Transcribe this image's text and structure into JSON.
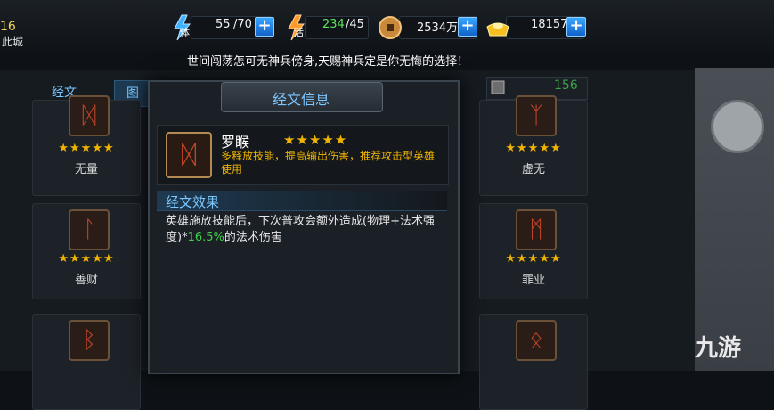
{
  "player": {
    "level": "16",
    "city": "此城"
  },
  "resources": [
    {
      "name": "stamina",
      "icon_label": "体",
      "value": "55",
      "max": "/70"
    },
    {
      "name": "energy",
      "icon_label": "活",
      "value": "234",
      "max": "/45"
    },
    {
      "name": "coins",
      "value": "2534万"
    },
    {
      "name": "gold",
      "value": "18157"
    }
  ],
  "slogan": "世间闯荡怎可无神兵傍身,天赐神兵定是你无悔的选择！",
  "tabs": {
    "left": "经文",
    "second": "图"
  },
  "counter": "156",
  "cards": [
    {
      "name": "无量",
      "stars": "★★★★★"
    },
    {
      "name": "善财",
      "stars": "★★★★★"
    },
    {
      "name": "虚无",
      "stars": "★★★★★"
    },
    {
      "name": "罪业",
      "stars": "★★★★★"
    }
  ],
  "dialog": {
    "title": "经文信息",
    "item": {
      "name": "罗睺",
      "stars": "★★★★★",
      "desc": "多释放技能，提高输出伤害，推荐攻击型英雄使用"
    },
    "effect": {
      "title": "经文效果",
      "text_before": "英雄施放技能后，下次普攻会额外造成(物理+法术强度)*",
      "highlight": "16.5%",
      "text_after": "的法术伤害"
    }
  },
  "watermark": "九游",
  "colors": {
    "accent_blue": "#7cc8ff",
    "star_gold": "#f0b400",
    "highlight_green": "#3fd34a"
  }
}
